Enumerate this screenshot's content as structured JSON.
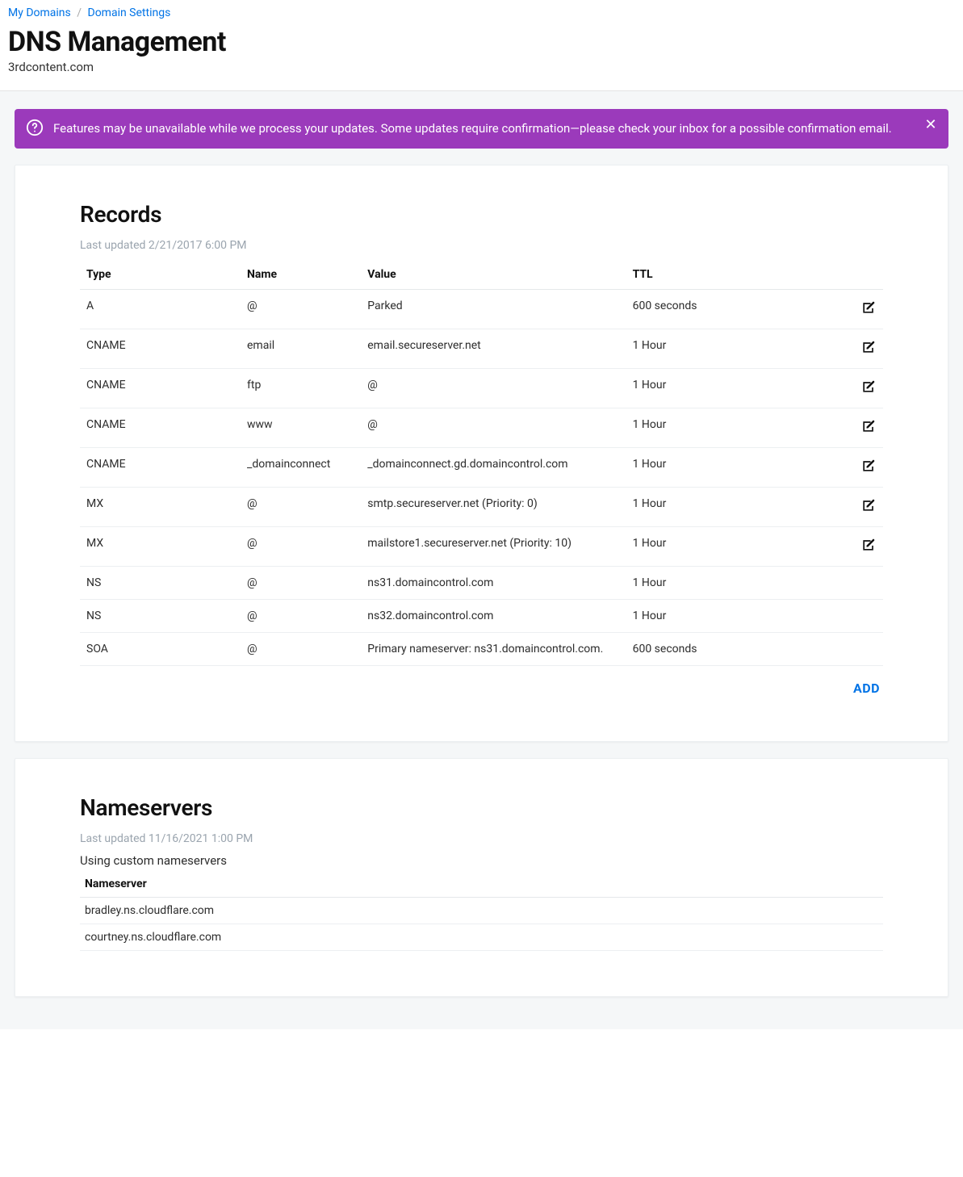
{
  "breadcrumb": {
    "my_domains": "My Domains",
    "domain_settings": "Domain Settings"
  },
  "header": {
    "title": "DNS Management",
    "domain": "3rdcontent.com"
  },
  "alert": {
    "text": "Features may be unavailable while we process your updates. Some updates require confirmation—please check your inbox for a possible confirmation email."
  },
  "records_card": {
    "title": "Records",
    "meta_prefix": "Last updated ",
    "meta_time": "2/21/2017 6:00 PM",
    "add_label": "ADD",
    "headers": {
      "type": "Type",
      "name": "Name",
      "value": "Value",
      "ttl": "TTL"
    },
    "rows": [
      {
        "type": "A",
        "name": "@",
        "value": "Parked",
        "ttl": "600 seconds",
        "editable": true
      },
      {
        "type": "CNAME",
        "name": "email",
        "value": "email.secureserver.net",
        "ttl": "1 Hour",
        "editable": true
      },
      {
        "type": "CNAME",
        "name": "ftp",
        "value": "@",
        "ttl": "1 Hour",
        "editable": true
      },
      {
        "type": "CNAME",
        "name": "www",
        "value": "@",
        "ttl": "1 Hour",
        "editable": true
      },
      {
        "type": "CNAME",
        "name": "_domainconnect",
        "value": "_domainconnect.gd.domaincontrol.com",
        "ttl": "1 Hour",
        "editable": true
      },
      {
        "type": "MX",
        "name": "@",
        "value": "smtp.secureserver.net (Priority: 0)",
        "ttl": "1 Hour",
        "editable": true
      },
      {
        "type": "MX",
        "name": "@",
        "value": "mailstore1.secureserver.net (Priority: 10)",
        "ttl": "1 Hour",
        "editable": true
      },
      {
        "type": "NS",
        "name": "@",
        "value": "ns31.domaincontrol.com",
        "ttl": "1 Hour",
        "editable": false
      },
      {
        "type": "NS",
        "name": "@",
        "value": "ns32.domaincontrol.com",
        "ttl": "1 Hour",
        "editable": false
      },
      {
        "type": "SOA",
        "name": "@",
        "value": "Primary nameserver: ns31.domaincontrol.com.",
        "ttl": "600 seconds",
        "editable": false
      }
    ]
  },
  "ns_card": {
    "title": "Nameservers",
    "meta_prefix": "Last updated ",
    "meta_time": "11/16/2021 1:00 PM",
    "using_text": "Using custom nameservers",
    "header": "Nameserver",
    "rows": [
      "bradley.ns.cloudflare.com",
      "courtney.ns.cloudflare.com"
    ]
  }
}
